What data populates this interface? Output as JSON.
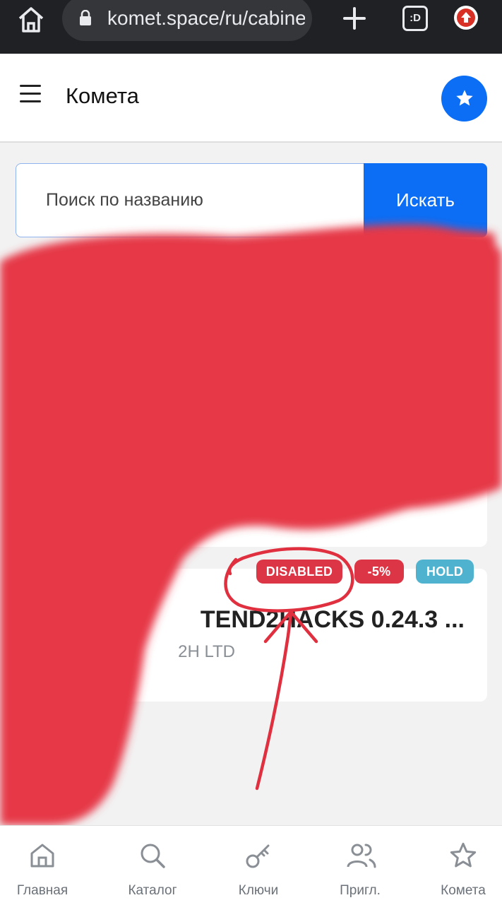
{
  "browser": {
    "url": "komet.space/ru/cabinet",
    "tabs_label": ":D"
  },
  "header": {
    "title": "Комета"
  },
  "search": {
    "placeholder": "Поиск по названию",
    "button_label": "Искать"
  },
  "product_card": {
    "badges": {
      "disabled": "DISABLED",
      "discount": "-5%",
      "hold": "HOLD"
    },
    "title": "TEND2HACKS 0.24.3 ...",
    "vendor": "2H LTD"
  },
  "nav": [
    {
      "label": "Главная",
      "icon": "home-icon"
    },
    {
      "label": "Каталог",
      "icon": "search-icon"
    },
    {
      "label": "Ключи",
      "icon": "key-icon"
    },
    {
      "label": "Пригл.",
      "icon": "users-icon"
    },
    {
      "label": "Комета",
      "icon": "star-icon"
    }
  ],
  "colors": {
    "primary": "#0b6ef5",
    "badge_red": "#dc3545",
    "badge_cyan": "#4fb3cf",
    "redaction": "#e63946"
  }
}
